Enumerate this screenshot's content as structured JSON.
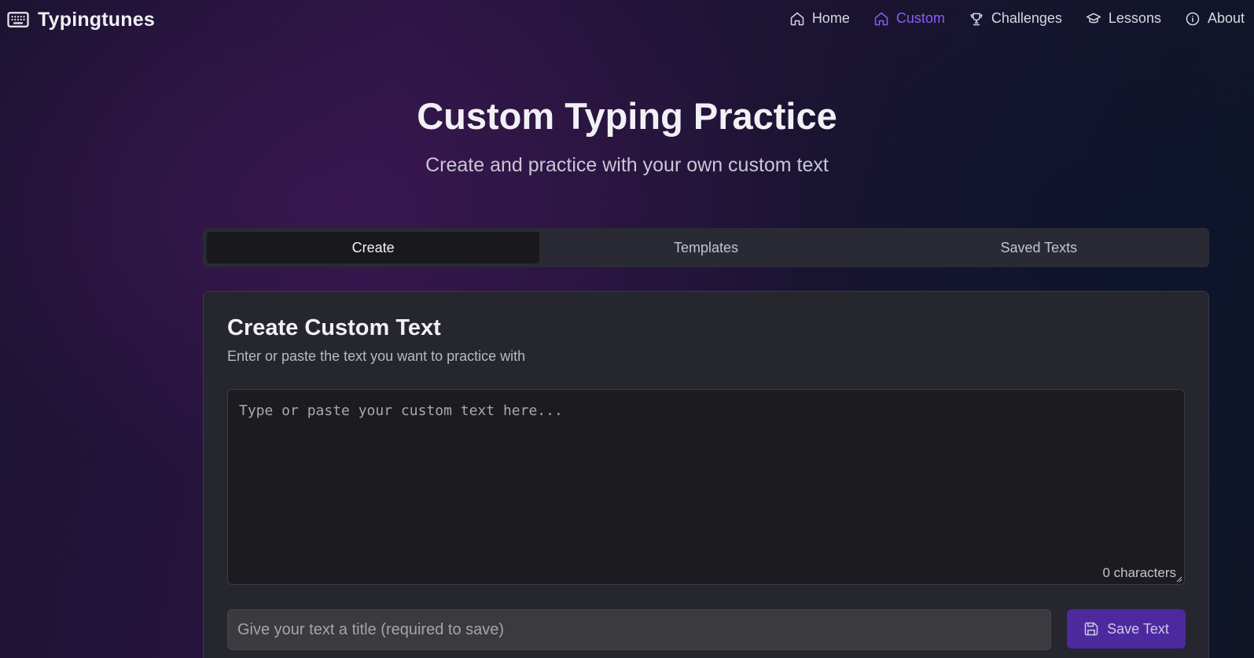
{
  "brand": {
    "name": "Typingtunes",
    "icon": "keyboard-icon"
  },
  "nav": {
    "items": [
      {
        "label": "Home",
        "icon": "home-icon",
        "active": false
      },
      {
        "label": "Custom",
        "icon": "home-icon",
        "active": true
      },
      {
        "label": "Challenges",
        "icon": "trophy-icon",
        "active": false
      },
      {
        "label": "Lessons",
        "icon": "graduation-cap-icon",
        "active": false
      },
      {
        "label": "About",
        "icon": "info-icon",
        "active": false
      }
    ]
  },
  "hero": {
    "title": "Custom Typing Practice",
    "subtitle": "Create and practice with your own custom text"
  },
  "tabs": [
    {
      "label": "Create",
      "active": true
    },
    {
      "label": "Templates",
      "active": false
    },
    {
      "label": "Saved Texts",
      "active": false
    }
  ],
  "card": {
    "title": "Create Custom Text",
    "description": "Enter or paste the text you want to practice with",
    "textarea_placeholder": "Type or paste your custom text here...",
    "textarea_value": "",
    "char_count": "0 characters",
    "title_placeholder": "Give your text a title (required to save)",
    "title_value": "",
    "save_label": "Save Text",
    "save_icon": "save-icon"
  },
  "colors": {
    "accent": "#8b5cf6",
    "button_bg": "#4c2a9e",
    "card_bg": "#26262e",
    "tab_active_bg": "#18181d"
  }
}
